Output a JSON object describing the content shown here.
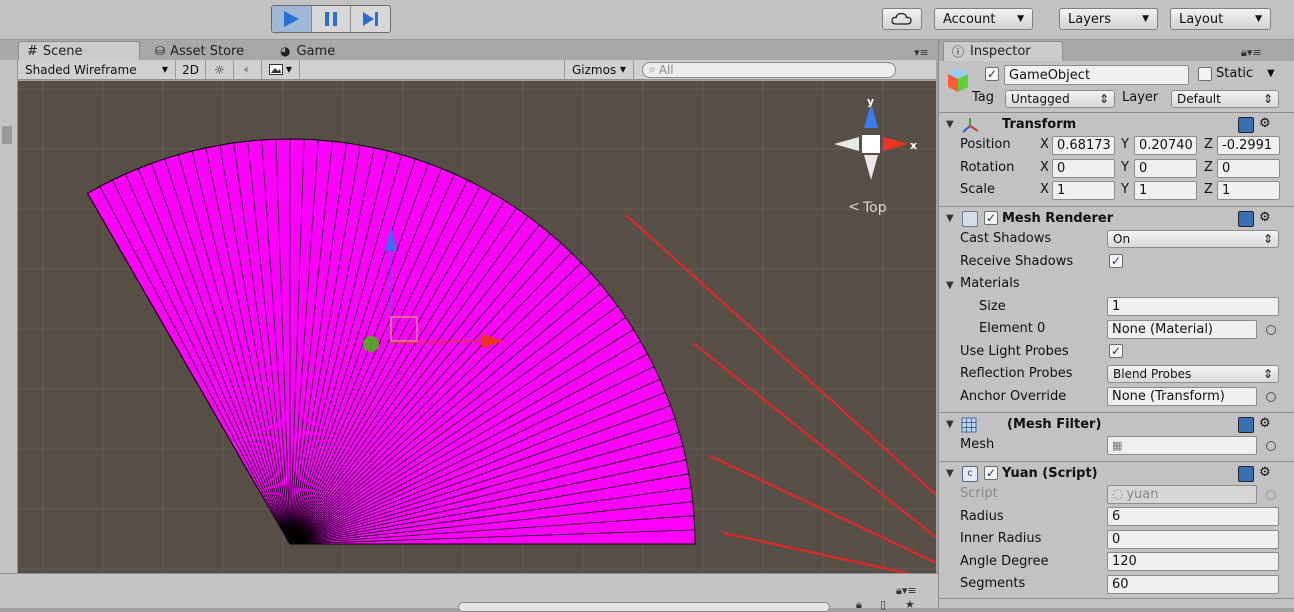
{
  "toolbar": {
    "account_label": "Account",
    "layers_label": "Layers",
    "layout_label": "Layout"
  },
  "tabs": {
    "scene": "Scene",
    "asset_store": "Asset Store",
    "game": "Game",
    "inspector": "Inspector"
  },
  "scene_toolbar": {
    "draw_mode": "Shaded Wireframe",
    "mode_2d": "2D",
    "gizmos": "Gizmos",
    "search_placeholder": "All"
  },
  "gizmo": {
    "axis_y": "y",
    "axis_x": "x",
    "view_label": "Top"
  },
  "mesh_preview": {
    "radius": 6,
    "inner_radius": 0,
    "angle_degree": 120,
    "segments": 60,
    "fill_color": "#ff00ff"
  },
  "inspector": {
    "object_name": "GameObject",
    "static_label": "Static",
    "tag_label": "Tag",
    "tag_value": "Untagged",
    "layer_label": "Layer",
    "layer_value": "Default",
    "transform": {
      "title": "Transform",
      "position_label": "Position",
      "rotation_label": "Rotation",
      "scale_label": "Scale",
      "x": "X",
      "y": "Y",
      "z": "Z",
      "position": [
        "0.68173",
        "0.20740",
        "-0.2991"
      ],
      "rotation": [
        "0",
        "0",
        "0"
      ],
      "scale": [
        "1",
        "1",
        "1"
      ]
    },
    "mesh_renderer": {
      "title": "Mesh Renderer",
      "cast_shadows_label": "Cast Shadows",
      "cast_shadows_value": "On",
      "receive_shadows_label": "Receive Shadows",
      "materials_label": "Materials",
      "size_label": "Size",
      "size_value": "1",
      "element0_label": "Element 0",
      "element0_value": "None (Material)",
      "light_probes_label": "Use Light Probes",
      "reflection_probes_label": "Reflection Probes",
      "reflection_probes_value": "Blend Probes",
      "anchor_override_label": "Anchor Override",
      "anchor_override_value": "None (Transform)"
    },
    "mesh_filter": {
      "title": "(Mesh Filter)",
      "mesh_label": "Mesh"
    },
    "script": {
      "title": "Yuan (Script)",
      "script_label": "Script",
      "script_value": "yuan",
      "radius_label": "Radius",
      "radius_value": "6",
      "inner_radius_label": "Inner Radius",
      "inner_radius_value": "0",
      "angle_label": "Angle Degree",
      "angle_value": "120",
      "segments_label": "Segments",
      "segments_value": "60"
    }
  },
  "colors": {
    "accent_blue": "#2a6fd6",
    "arrow_red": "#ee3322",
    "viewport_bg": "#574f46"
  }
}
